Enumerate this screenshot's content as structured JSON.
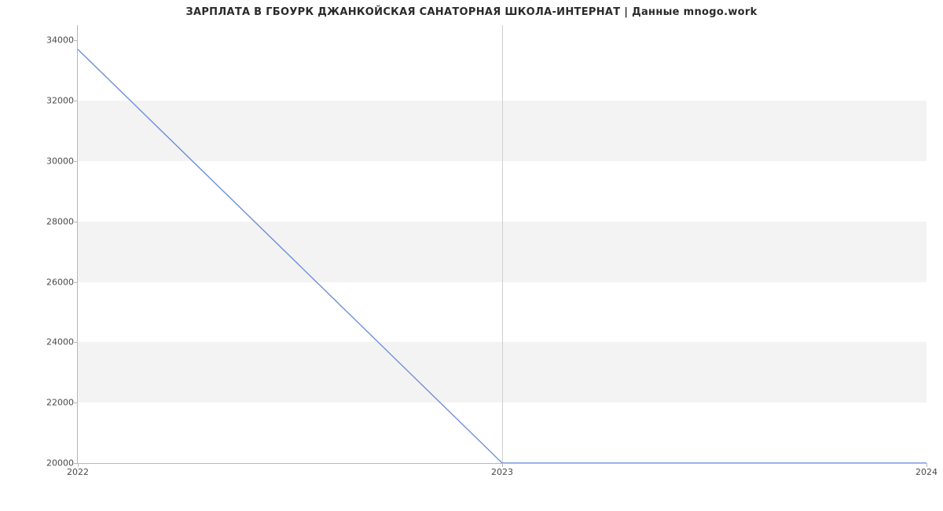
{
  "chart_data": {
    "type": "line",
    "title": "ЗАРПЛАТА В ГБОУРК  ДЖАНКОЙСКАЯ САНАТОРНАЯ ШКОЛА-ИНТЕРНАТ | Данные mnogo.work",
    "xlabel": "",
    "ylabel": "",
    "x_categories": [
      "2022",
      "2023",
      "2024"
    ],
    "y_ticks": [
      20000,
      22000,
      24000,
      26000,
      28000,
      30000,
      32000,
      34000
    ],
    "ylim": [
      20000,
      34500
    ],
    "series": [
      {
        "name": "salary",
        "x": [
          "2022",
          "2023",
          "2024"
        ],
        "y": [
          33700,
          20000,
          20000
        ]
      }
    ],
    "colors": {
      "line": "#6f8fd9",
      "band": "#f3f3f3",
      "axis": "#b7b7b7"
    }
  },
  "y_tick_labels": [
    "20000",
    "22000",
    "24000",
    "26000",
    "28000",
    "30000",
    "32000",
    "34000"
  ],
  "x_tick_labels": [
    "2022",
    "2023",
    "2024"
  ]
}
